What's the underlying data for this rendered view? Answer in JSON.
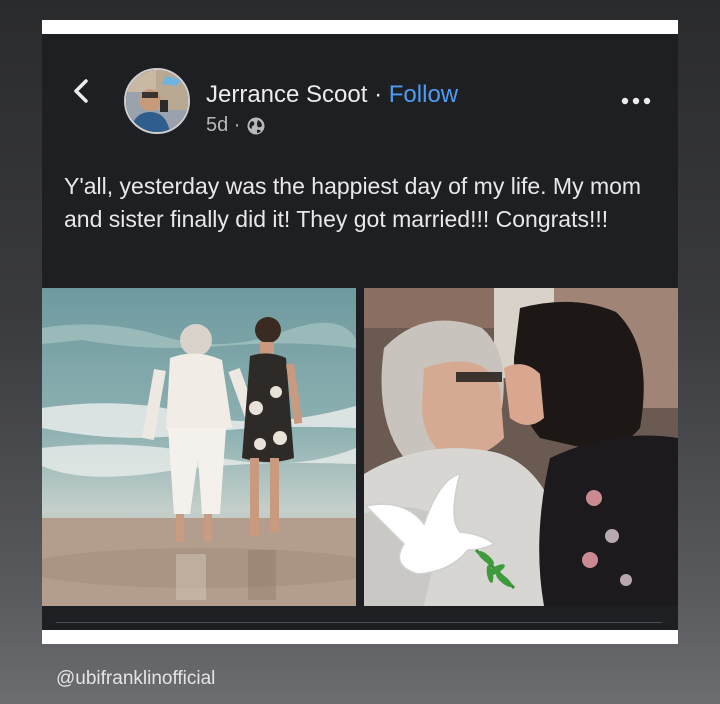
{
  "post": {
    "author": "Jerrance Scoot",
    "separator": "·",
    "follow_label": "Follow",
    "time": "5d ·",
    "caption": "Y'all, yesterday was the happiest day of my life. My mom and sister finally did it! They got married!!! Congrats!!!"
  },
  "icons": {
    "back": "chevron-left-icon",
    "privacy": "globe-icon",
    "more": "more-horizontal-icon"
  },
  "colors": {
    "post_background": "#1e1f23",
    "follow": "#4f9cf5",
    "text": "#e8e8ea"
  },
  "watermark": "@ubifranklinofficial"
}
